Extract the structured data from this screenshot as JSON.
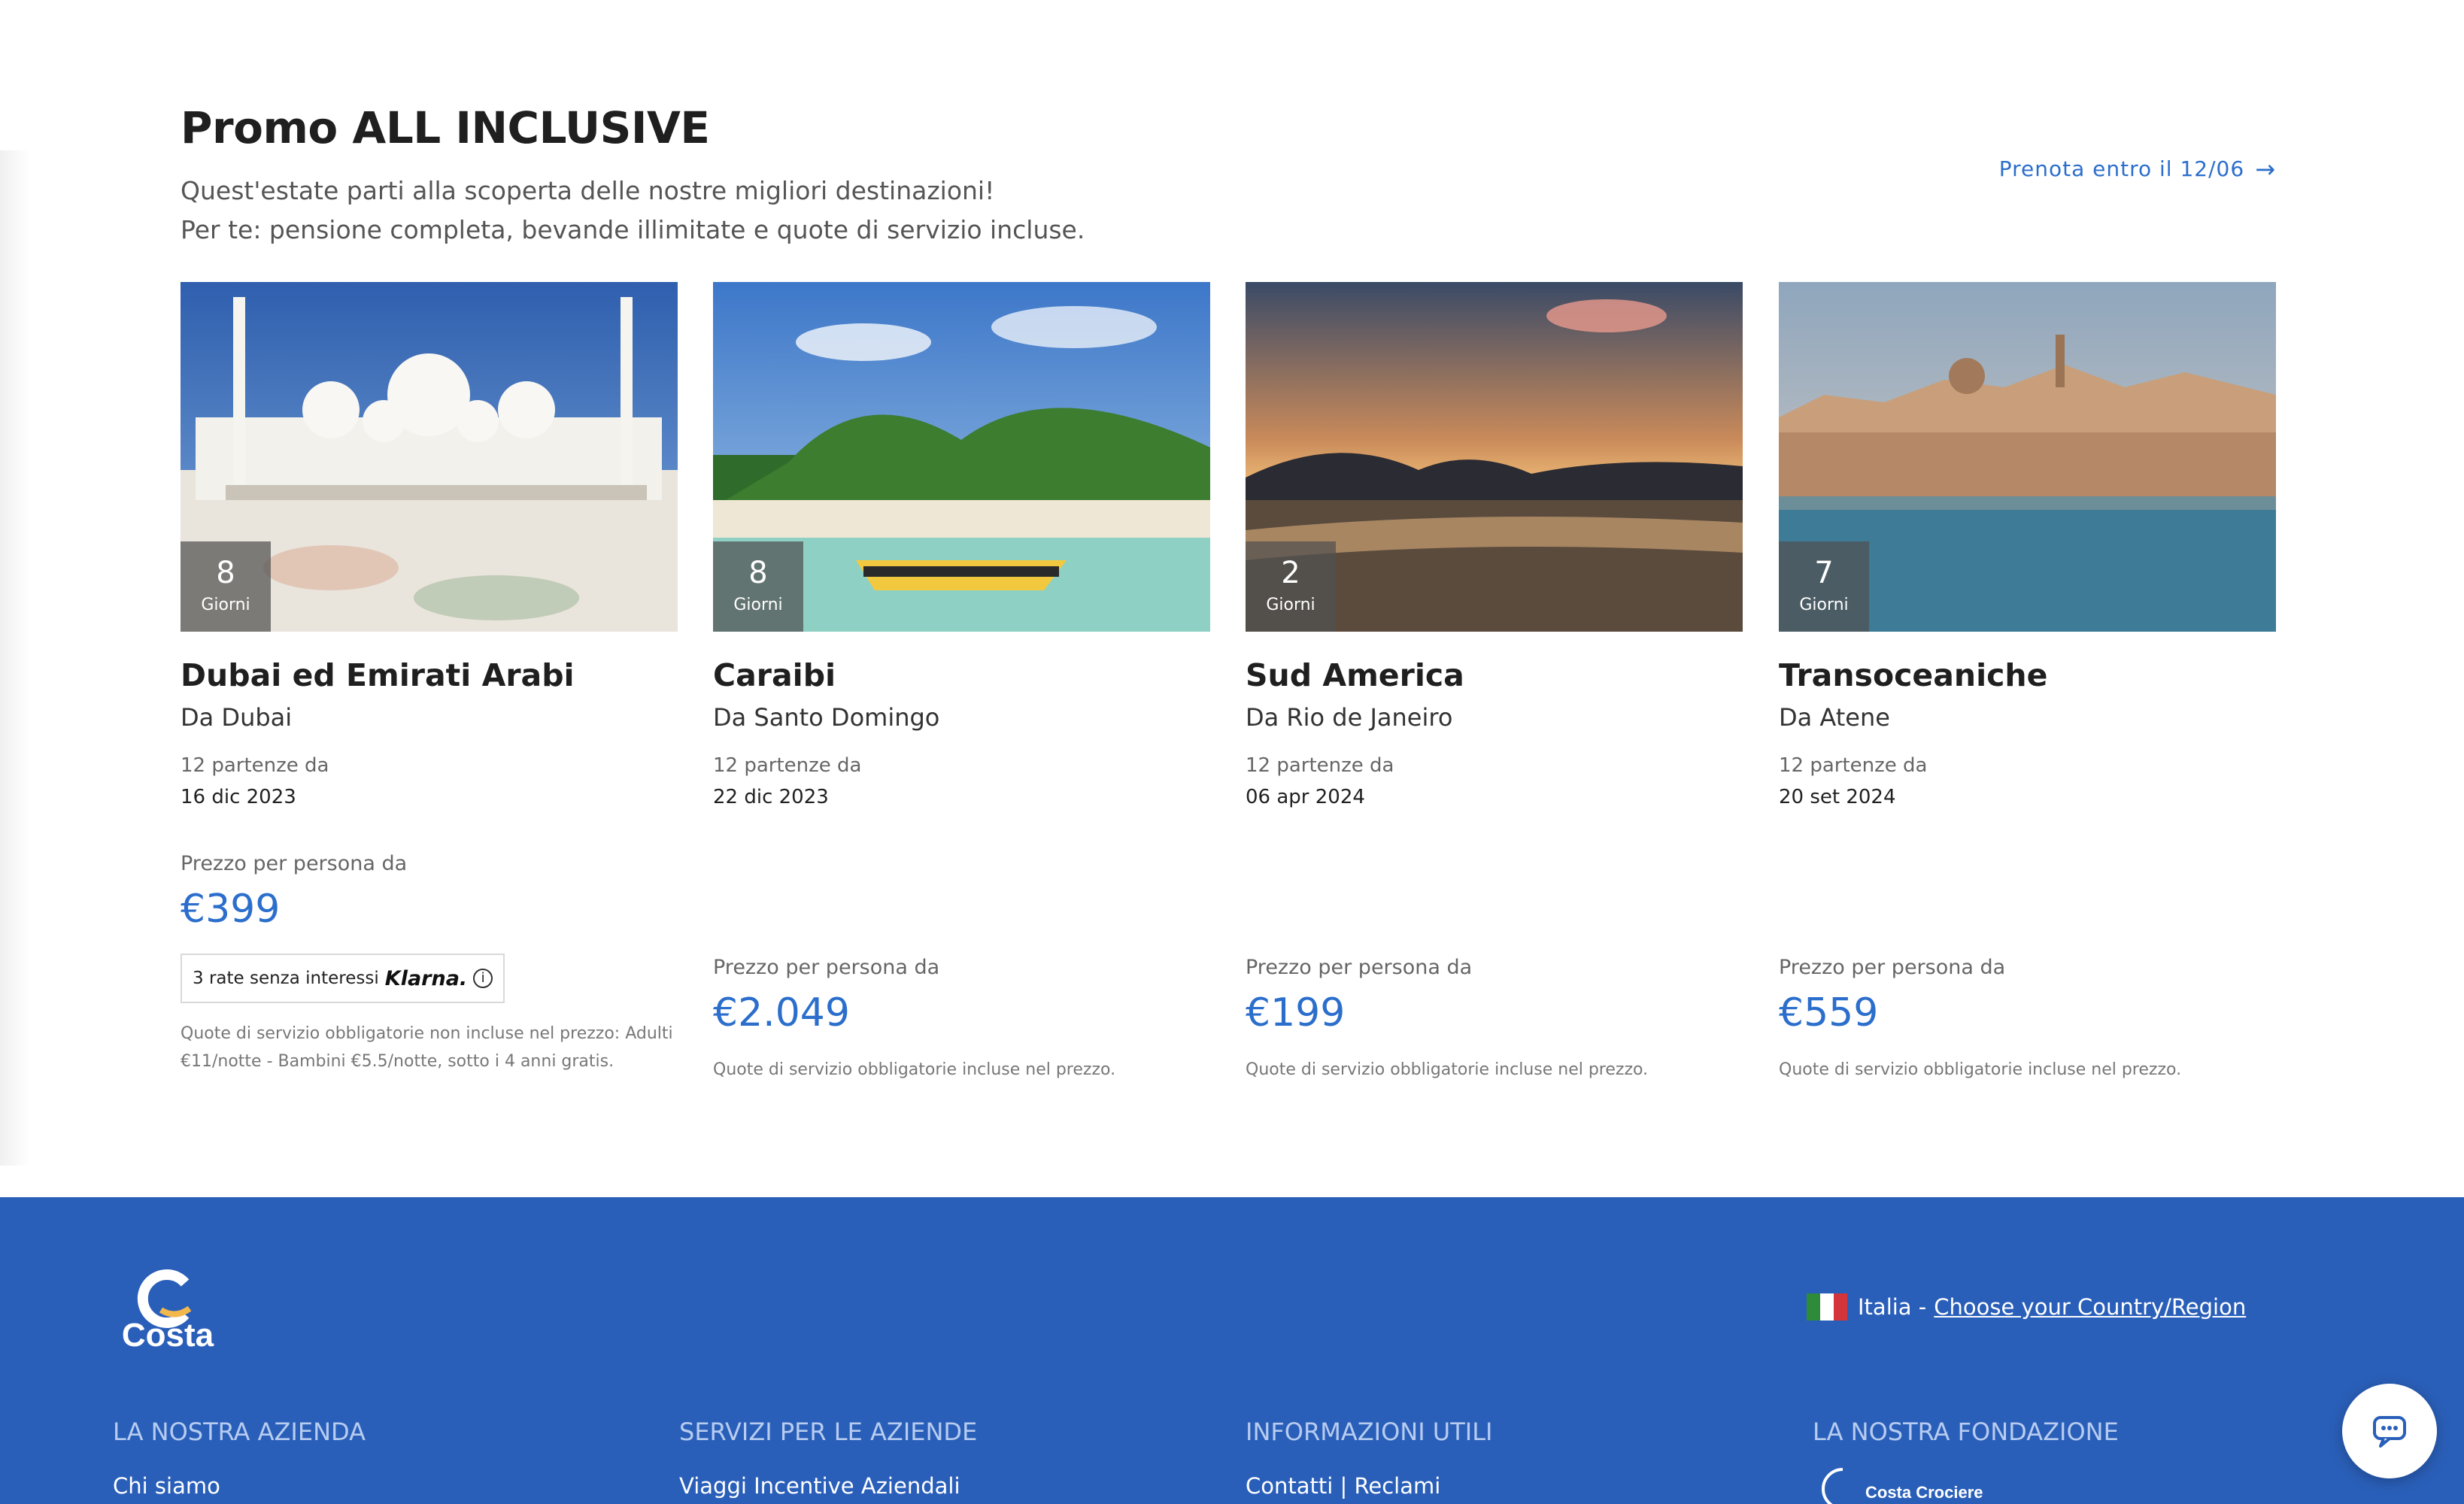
{
  "promo": {
    "title": "Promo ALL INCLUSIVE",
    "subtitle_line1": "Quest'estate parti alla scoperta delle nostre migliori destinazioni!",
    "subtitle_line2": "Per te: pensione completa, bevande illimitate e quote di servizio incluse.",
    "link_label": "Prenota entro il 12/06",
    "link_arrow": "→"
  },
  "cards": [
    {
      "days": "8",
      "days_label": "Giorni",
      "title": "Dubai ed Emirati Arabi",
      "from": "Da Dubai",
      "departures_label": "12 partenze da",
      "departure_date": "16 dic 2023",
      "price_label": "Prezzo per persona da",
      "price": "€399",
      "klarna_text": "3 rate senza interessi",
      "klarna_brand": "Klarna.",
      "fees": "Quote di servizio obbligatorie non incluse nel prezzo: Adulti €11/notte - Bambini €5.5/notte, sotto i 4 anni gratis."
    },
    {
      "days": "8",
      "days_label": "Giorni",
      "title": "Caraibi",
      "from": "Da Santo Domingo",
      "departures_label": "12 partenze da",
      "departure_date": "22 dic 2023",
      "price_label": "Prezzo per persona da",
      "price": "€2.049",
      "fees": "Quote di servizio obbligatorie incluse nel prezzo."
    },
    {
      "days": "2",
      "days_label": "Giorni",
      "title": "Sud America",
      "from": "Da Rio de Janeiro",
      "departures_label": "12 partenze da",
      "departure_date": "06 apr 2024",
      "price_label": "Prezzo per persona da",
      "price": "€199",
      "fees": "Quote di servizio obbligatorie incluse nel prezzo."
    },
    {
      "days": "7",
      "days_label": "Giorni",
      "title": "Transoceaniche",
      "from": "Da Atene",
      "departures_label": "12 partenze da",
      "departure_date": "20 set 2024",
      "price_label": "Prezzo per persona da",
      "price": "€559",
      "fees": "Quote di servizio obbligatorie incluse nel prezzo."
    }
  ],
  "footer": {
    "logo_text": "Costa",
    "country_text": "Italia -",
    "country_link": "Choose your Country/Region",
    "columns": [
      {
        "heading": "LA NOSTRA AZIENDA",
        "first_item": "Chi siamo"
      },
      {
        "heading": "SERVIZI PER LE AZIENDE",
        "first_item": "Viaggi Incentive Aziendali"
      },
      {
        "heading": "INFORMAZIONI UTILI",
        "first_item": "Contatti | Reclami"
      },
      {
        "heading": "LA NOSTRA FONDAZIONE"
      }
    ],
    "foundation_logo_text": "Costa Crociere"
  },
  "colors": {
    "accent_blue": "#2b6ecc",
    "footer_blue": "#2a5fb9"
  }
}
